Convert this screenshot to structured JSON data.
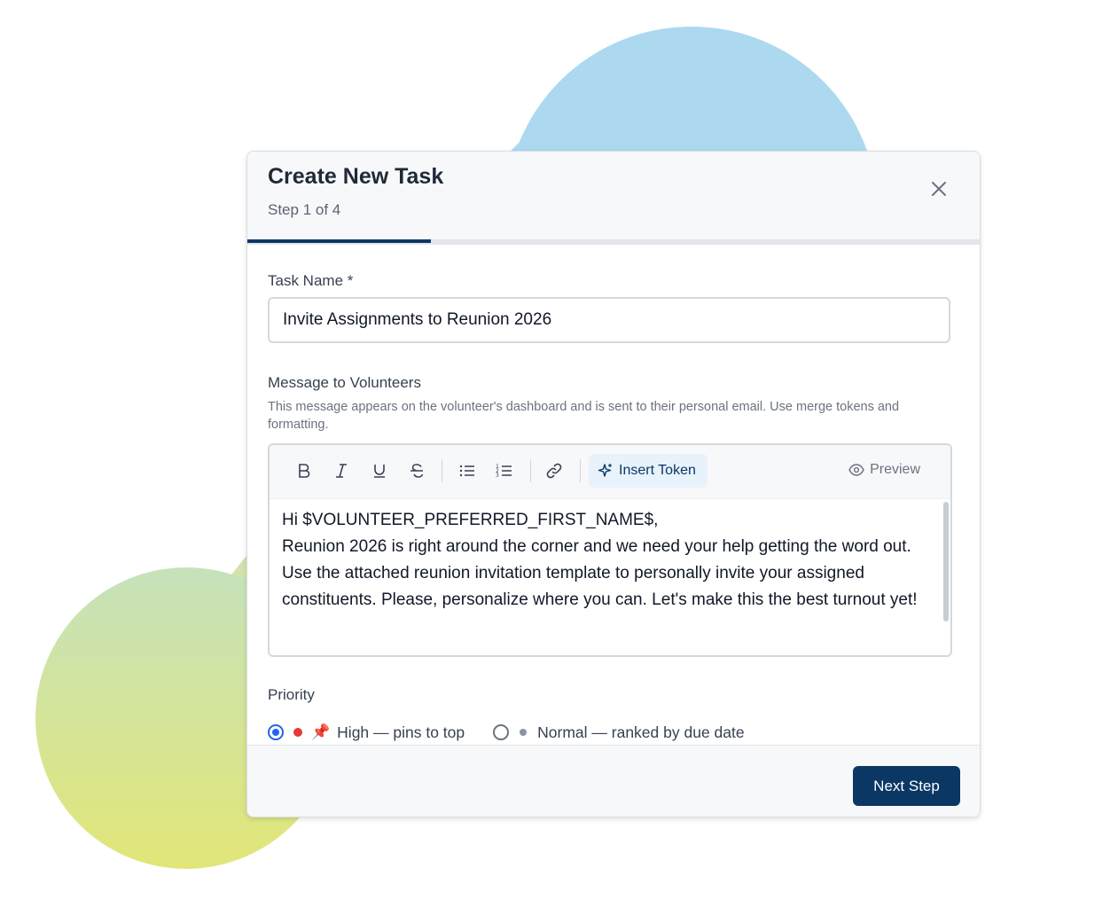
{
  "modal": {
    "title": "Create New Task",
    "step": "Step 1 of 4",
    "progress_fraction": 0.25
  },
  "task_name": {
    "label": "Task Name *",
    "value": "Invite Assignments to Reunion 2026"
  },
  "message": {
    "label": "Message to Volunteers",
    "help": "This message appears on the volunteer's dashboard and is sent to their personal email. Use merge tokens and formatting.",
    "toolbar": {
      "bold_icon": "bold-icon",
      "italic_icon": "italic-icon",
      "underline_icon": "underline-icon",
      "strike_icon": "strikethrough-icon",
      "bullet_icon": "bulleted-list-icon",
      "numbered_icon": "numbered-list-icon",
      "link_icon": "link-icon",
      "insert_token_label": "Insert Token",
      "preview_label": "Preview"
    },
    "lines": [
      "Hi $VOLUNTEER_PREFERRED_FIRST_NAME$,",
      "Reunion 2026 is right around the corner and we need your help getting the word out. Use the attached reunion invitation template to personally invite your assigned constituents. Please, personalize where you can.  Let's make this the best turnout yet!"
    ]
  },
  "priority": {
    "label": "Priority",
    "options": [
      {
        "label": "High — pins to top",
        "selected": true,
        "dot_color": "#e53935",
        "icon": "📌"
      },
      {
        "label": "Normal — ranked by due date",
        "selected": false,
        "dot_color": "#8a94a3"
      }
    ]
  },
  "footer": {
    "next_label": "Next Step"
  },
  "colors": {
    "primary": "#0b3764",
    "radio_accent": "#2563eb"
  }
}
